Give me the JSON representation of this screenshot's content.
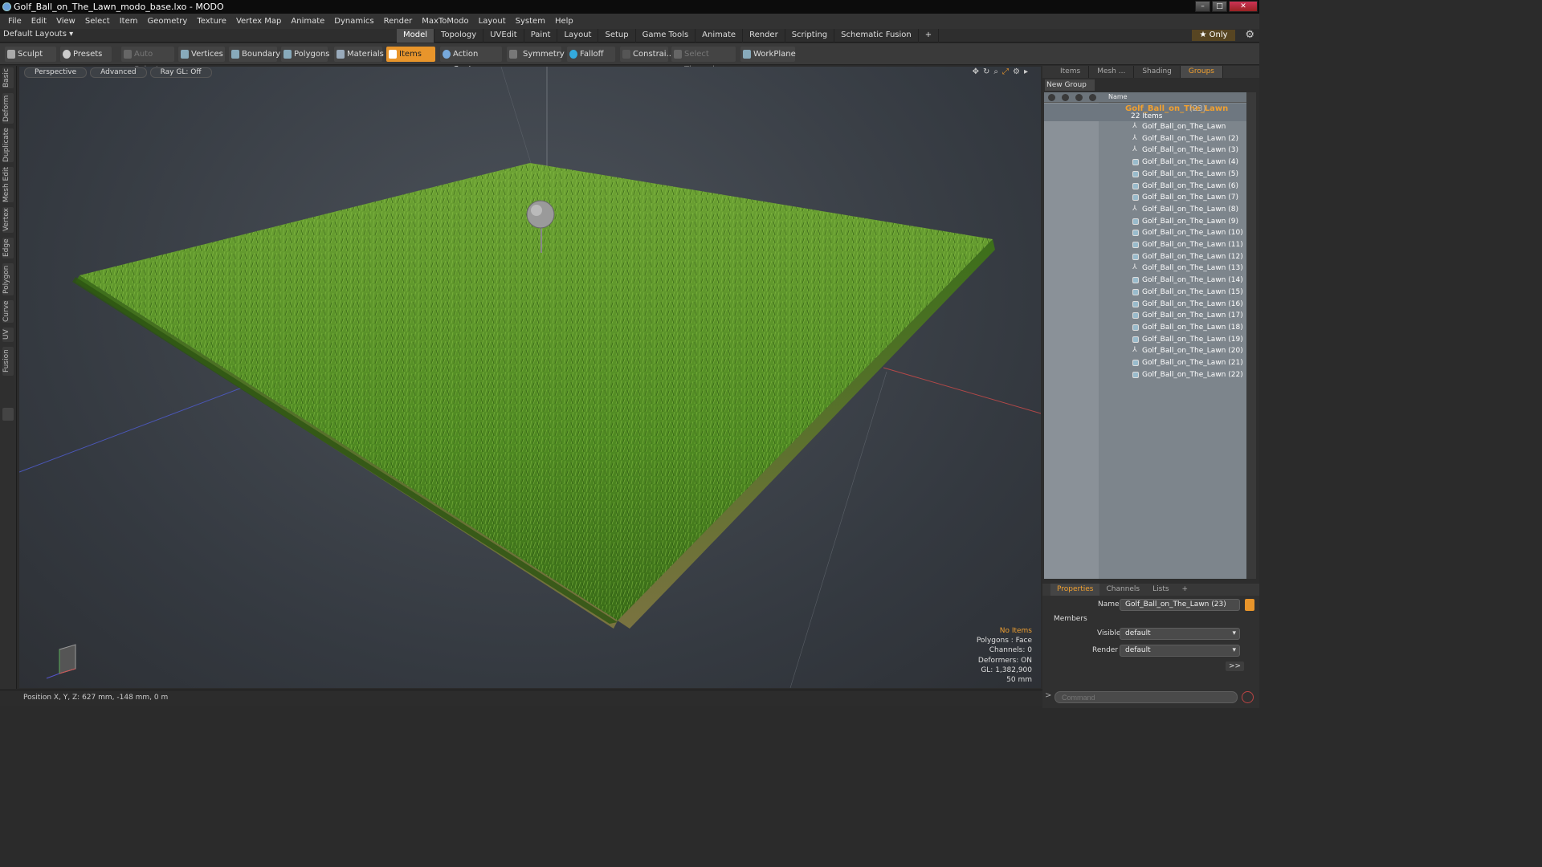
{
  "window": {
    "title": "Golf_Ball_on_The_Lawn_modo_base.lxo - MODO"
  },
  "menu": [
    "File",
    "Edit",
    "View",
    "Select",
    "Item",
    "Geometry",
    "Texture",
    "Vertex Map",
    "Animate",
    "Dynamics",
    "Render",
    "MaxToModo",
    "Layout",
    "System",
    "Help"
  ],
  "layout_bar": {
    "layout_name": "Default Layouts ▾",
    "tabs": [
      "Model",
      "Topology",
      "UVEdit",
      "Paint",
      "Layout",
      "Setup",
      "Game Tools",
      "Animate",
      "Render",
      "Scripting",
      "Schematic Fusion",
      "+"
    ],
    "active_tab": "Model",
    "only_label": "★ Only"
  },
  "toolbar": {
    "sculpt": "Sculpt",
    "presets": "Presets",
    "auto_select": "Auto Select",
    "vertices": "Vertices",
    "boundary": "Boundary",
    "polygons": "Polygons",
    "materials": "Materials",
    "items": "Items",
    "action_center": "Action Center",
    "symmetry": "Symmetry",
    "falloff": "Falloff",
    "constraints": "Constrai...",
    "select_through": "Select Through",
    "workplane": "WorkPlane"
  },
  "left_tabs": [
    "Basic",
    "Deform",
    "Duplicate",
    "Mesh Edit",
    "Vertex",
    "Edge",
    "Polygon",
    "Curve",
    "UV",
    "Fusion"
  ],
  "viewport": {
    "view": "Perspective",
    "shading": "Advanced",
    "raygl": "Ray GL: Off",
    "hud": {
      "items": "No Items",
      "polygons": "Polygons : Face",
      "channels": "Channels: 0",
      "deformers": "Deformers: ON",
      "gl": "GL: 1,382,900",
      "scale": "50 mm"
    },
    "colors": {
      "grass_light": "#7cb83a",
      "grass_dark": "#2f5e14",
      "background": "#3f454c"
    }
  },
  "status": {
    "position": "Position X, Y, Z:  627 mm, -148 mm, 0 m"
  },
  "right_panel": {
    "tabs": [
      "Items",
      "Mesh ...",
      "Shading",
      "Groups"
    ],
    "active_tab": "Groups",
    "new_group": "New Group",
    "column_name": "Name",
    "group": {
      "name": "Golf_Ball_on_The_Lawn",
      "count": "(23)",
      "subtitle": "22 Items"
    },
    "items": [
      {
        "label": "Golf_Ball_on_The_Lawn",
        "kind": "locator"
      },
      {
        "label": "Golf_Ball_on_The_Lawn (2)",
        "kind": "locator"
      },
      {
        "label": "Golf_Ball_on_The_Lawn (3)",
        "kind": "locator"
      },
      {
        "label": "Golf_Ball_on_The_Lawn (4)",
        "kind": "mesh"
      },
      {
        "label": "Golf_Ball_on_The_Lawn (5)",
        "kind": "mesh"
      },
      {
        "label": "Golf_Ball_on_The_Lawn (6)",
        "kind": "mesh"
      },
      {
        "label": "Golf_Ball_on_The_Lawn (7)",
        "kind": "mesh"
      },
      {
        "label": "Golf_Ball_on_The_Lawn (8)",
        "kind": "locator"
      },
      {
        "label": "Golf_Ball_on_The_Lawn (9)",
        "kind": "mesh"
      },
      {
        "label": "Golf_Ball_on_The_Lawn (10)",
        "kind": "mesh"
      },
      {
        "label": "Golf_Ball_on_The_Lawn (11)",
        "kind": "mesh"
      },
      {
        "label": "Golf_Ball_on_The_Lawn (12)",
        "kind": "mesh"
      },
      {
        "label": "Golf_Ball_on_The_Lawn (13)",
        "kind": "locator"
      },
      {
        "label": "Golf_Ball_on_The_Lawn (14)",
        "kind": "mesh"
      },
      {
        "label": "Golf_Ball_on_The_Lawn (15)",
        "kind": "mesh"
      },
      {
        "label": "Golf_Ball_on_The_Lawn (16)",
        "kind": "mesh"
      },
      {
        "label": "Golf_Ball_on_The_Lawn (17)",
        "kind": "mesh"
      },
      {
        "label": "Golf_Ball_on_The_Lawn (18)",
        "kind": "mesh"
      },
      {
        "label": "Golf_Ball_on_The_Lawn (19)",
        "kind": "mesh"
      },
      {
        "label": "Golf_Ball_on_The_Lawn (20)",
        "kind": "locator"
      },
      {
        "label": "Golf_Ball_on_The_Lawn (21)",
        "kind": "mesh"
      },
      {
        "label": "Golf_Ball_on_The_Lawn (22)",
        "kind": "mesh"
      }
    ]
  },
  "properties": {
    "tabs": [
      "Properties",
      "Channels",
      "Lists",
      "+"
    ],
    "active_tab": "Properties",
    "name_label": "Name",
    "name_value": "Golf_Ball_on_The_Lawn (23)",
    "section": "Members",
    "visible_label": "Visible",
    "visible_value": "default",
    "render_label": "Render",
    "render_value": "default",
    "more": ">>"
  },
  "command": {
    "placeholder": "Command",
    "prompt": ">"
  }
}
